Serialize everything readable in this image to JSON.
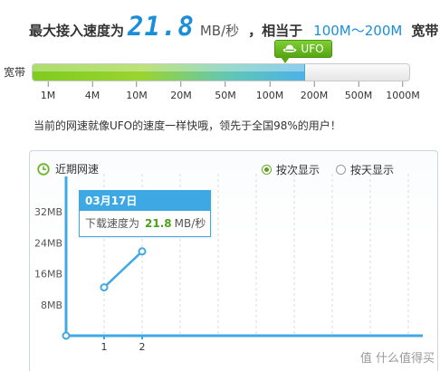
{
  "header": {
    "prefix": "最大接入速度为",
    "speed": "21.8",
    "speed_unit": "MB/秒",
    "equivalent_prefix": "，相当于",
    "range": "100M～200M",
    "suffix": "宽带"
  },
  "bandwidth": {
    "label": "宽带",
    "badge": "UFO",
    "badge_icon": "ufo-icon",
    "level_fraction": 0.72,
    "ticks": [
      "1M",
      "4M",
      "10M",
      "20M",
      "50M",
      "100M",
      "200M",
      "500M",
      "1000M"
    ]
  },
  "comparison": "当前的网速就像UFO的速度一样快哦，领先于全国98%的用户！",
  "recent": {
    "title": "近期网速",
    "title_icon": "clock-icon",
    "options": [
      {
        "label": "按次显示",
        "selected": true
      },
      {
        "label": "按天显示",
        "selected": false
      }
    ]
  },
  "tooltip": {
    "date": "03月17日",
    "label": "下载速度为",
    "value": "21.8",
    "unit": "MB/秒"
  },
  "chart_data": {
    "type": "line",
    "x": [
      1,
      2
    ],
    "series": [
      {
        "values": [
          12.5,
          21.8
        ]
      }
    ],
    "yticks": [
      "32MB",
      "24MB",
      "16MB",
      "8MB"
    ],
    "xticks": [
      "1",
      "2"
    ],
    "ylim": [
      0,
      40
    ],
    "line_color": "#3fa9e5",
    "grid": "dashed vertical"
  },
  "watermark": "值 什么值得买"
}
